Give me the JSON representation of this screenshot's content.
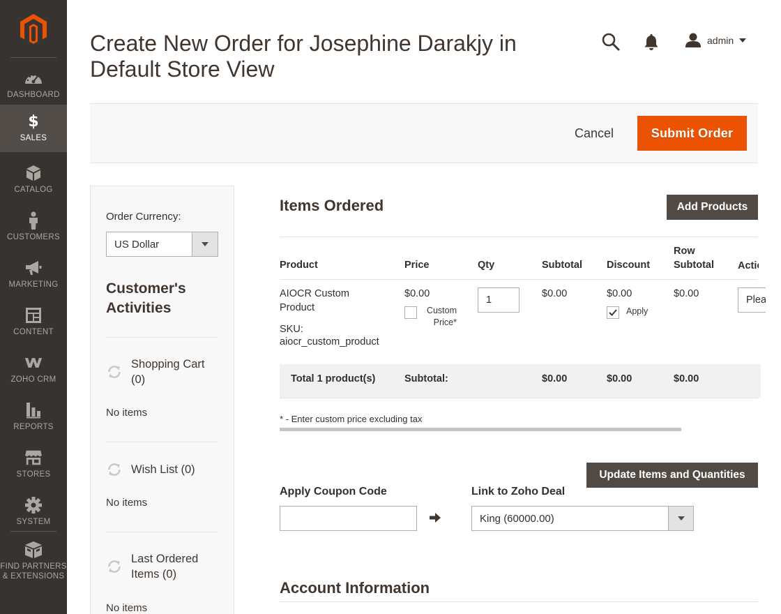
{
  "colors": {
    "sidebar_bg": "#373330",
    "sidebar_active": "#524d49",
    "accent": "#eb5202",
    "dark_button": "#514943"
  },
  "sidebar": {
    "logo": "magento-logo",
    "items": [
      {
        "label": "DASHBOARD",
        "icon": "dashboard-icon",
        "active": false
      },
      {
        "label": "SALES",
        "icon": "dollar-icon",
        "active": true
      },
      {
        "label": "CATALOG",
        "icon": "cube-icon",
        "active": false
      },
      {
        "label": "CUSTOMERS",
        "icon": "person-icon",
        "active": false
      },
      {
        "label": "MARKETING",
        "icon": "megaphone-icon",
        "active": false
      },
      {
        "label": "CONTENT",
        "icon": "layout-icon",
        "active": false
      },
      {
        "label": "ZOHO CRM",
        "icon": "zoho-icon",
        "active": false
      },
      {
        "label": "REPORTS",
        "icon": "bar-chart-icon",
        "active": false
      },
      {
        "label": "STORES",
        "icon": "store-icon",
        "active": false
      },
      {
        "label": "SYSTEM",
        "icon": "gear-icon",
        "active": false
      },
      {
        "label_line1": "FIND PARTNERS",
        "label_line2": "& EXTENSIONS",
        "icon": "box-icon",
        "active": false
      }
    ]
  },
  "header": {
    "title": "Create New Order for Josephine Darakjy in Default Store View",
    "user": "admin"
  },
  "actions": {
    "cancel": "Cancel",
    "submit": "Submit Order"
  },
  "left": {
    "currency_label": "Order Currency:",
    "currency_value": "US Dollar",
    "activities_title": "Customer's Activities",
    "shopping_cart": "Shopping Cart (0)",
    "wish_list": "Wish List (0)",
    "last_ordered": "Last Ordered Items (0)",
    "no_items": "No items"
  },
  "items": {
    "title": "Items Ordered",
    "add_products": "Add Products",
    "columns": {
      "product": "Product",
      "price": "Price",
      "qty": "Qty",
      "subtotal": "Subtotal",
      "discount": "Discount",
      "row_subtotal": "Row Subtotal",
      "action": "Action"
    },
    "row": {
      "name": "AIOCR Custom Product",
      "sku_label": "SKU:",
      "sku": "aiocr_custom_product",
      "price": "$0.00",
      "custom_price_label": "Custom Price*",
      "custom_price_checked": false,
      "qty": "1",
      "subtotal": "$0.00",
      "discount": "$0.00",
      "apply_label": "Apply",
      "apply_checked": true,
      "row_subtotal": "$0.00",
      "action_value": "Please select"
    },
    "totals": {
      "label": "Total 1 product(s)",
      "subtotal_label": "Subtotal:",
      "subtotal": "$0.00",
      "discount": "$0.00",
      "row_subtotal": "$0.00"
    },
    "note": "* - Enter custom price excluding tax",
    "update_button": "Update Items and Quantities"
  },
  "coupon": {
    "label": "Apply Coupon Code",
    "value": ""
  },
  "zoho": {
    "label": "Link to Zoho Deal",
    "value": "King (60000.00)"
  },
  "account_title": "Account Information"
}
